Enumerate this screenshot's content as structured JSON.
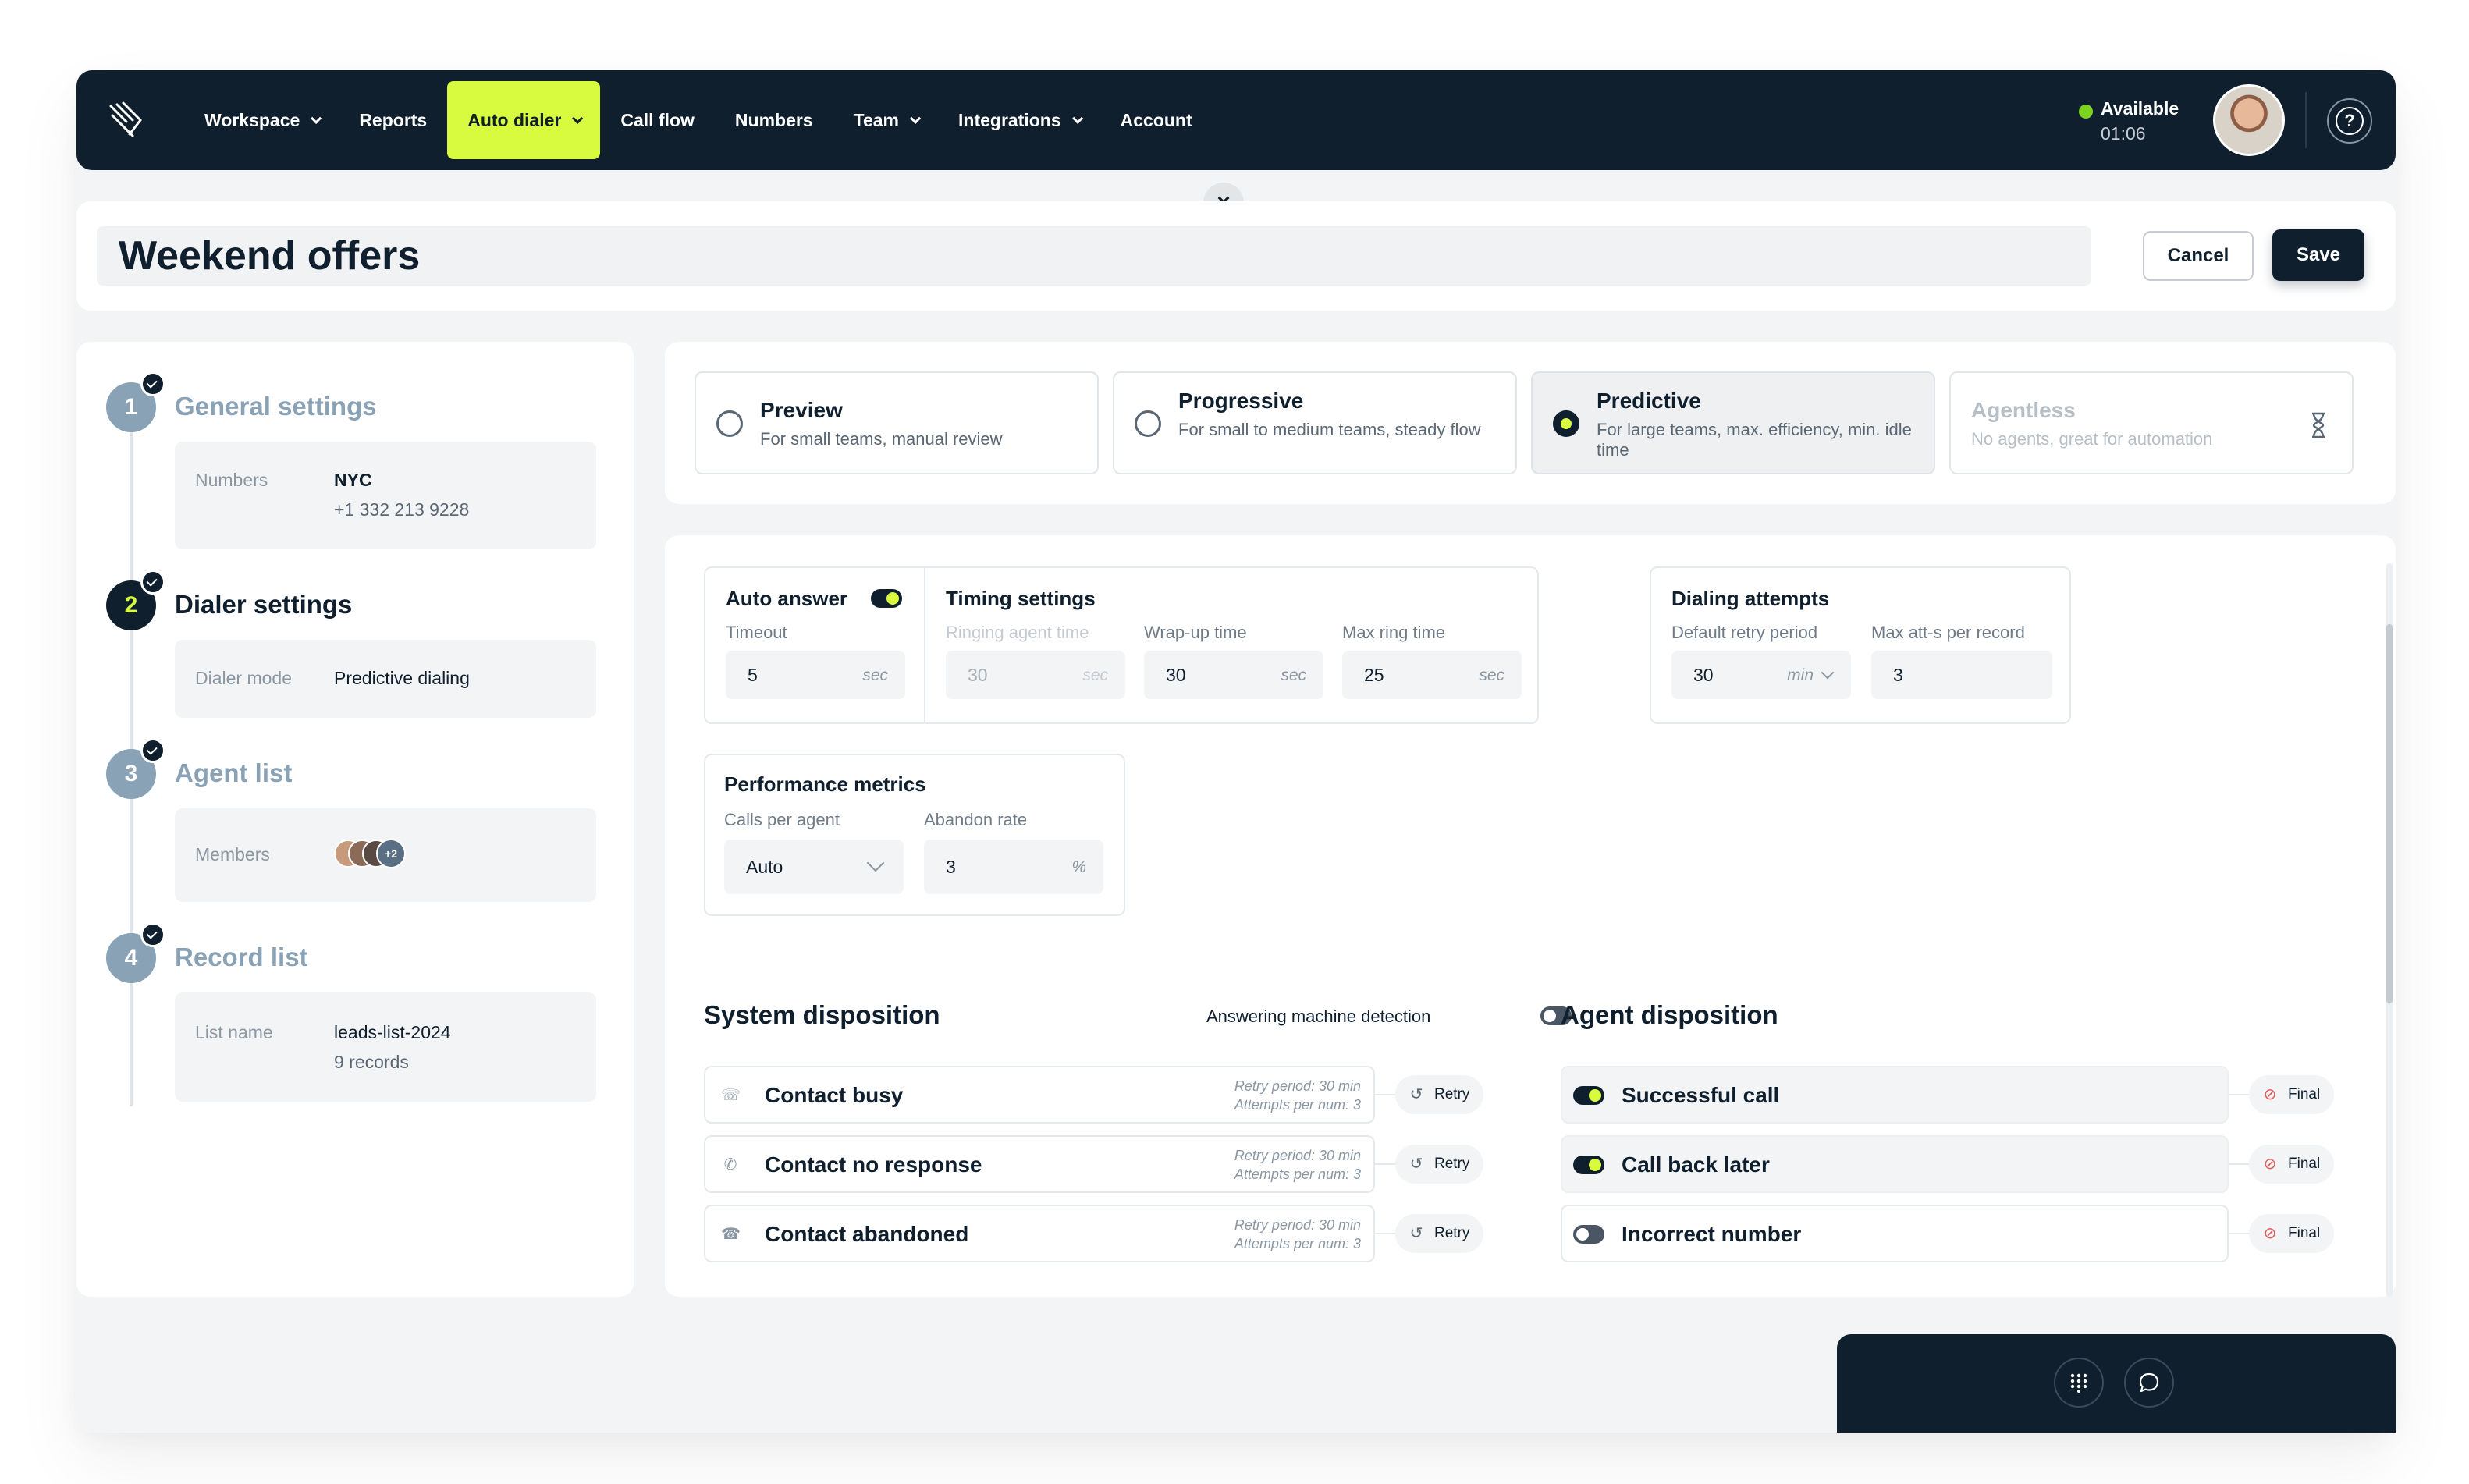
{
  "nav": {
    "items": [
      {
        "label": "Workspace",
        "dropdown": true
      },
      {
        "label": "Reports",
        "dropdown": false
      },
      {
        "label": "Auto dialer",
        "dropdown": true,
        "active": true
      },
      {
        "label": "Call flow",
        "dropdown": false
      },
      {
        "label": "Numbers",
        "dropdown": false
      },
      {
        "label": "Team",
        "dropdown": true
      },
      {
        "label": "Integrations",
        "dropdown": true
      },
      {
        "label": "Account",
        "dropdown": false
      }
    ],
    "status_label": "Available",
    "status_time": "01:06",
    "help_icon": "?"
  },
  "close_icon": "×",
  "header": {
    "title": "Weekend offers",
    "cancel_label": "Cancel",
    "save_label": "Save"
  },
  "steps": [
    {
      "num": "1",
      "title": "General settings",
      "box_label": "Numbers",
      "box_value": "NYC",
      "box_value2": "+1 332 213 9228"
    },
    {
      "num": "2",
      "title": "Dialer settings",
      "box_label": "Dialer mode",
      "box_value": "Predictive dialing"
    },
    {
      "num": "3",
      "title": "Agent list",
      "box_label": "Members",
      "more": "+2"
    },
    {
      "num": "4",
      "title": "Record list",
      "box_label": "List name",
      "box_value": "leads-list-2024",
      "box_value2": "9 records"
    }
  ],
  "modes": [
    {
      "title": "Preview",
      "desc": "For small teams, manual review"
    },
    {
      "title": "Progressive",
      "desc": "For small to medium teams, steady flow"
    },
    {
      "title": "Predictive",
      "desc": "For large teams, max. efficiency, min. idle time"
    },
    {
      "title": "Agentless",
      "desc": "No agents, great for automation"
    }
  ],
  "auto_answer": {
    "title": "Auto answer",
    "timeout_label": "Timeout",
    "timeout_value": "5",
    "timeout_unit": "sec"
  },
  "timing": {
    "title": "Timing settings",
    "ringing_label": "Ringing agent time",
    "ringing_value": "30",
    "ringing_unit": "sec",
    "wrapup_label": "Wrap-up time",
    "wrapup_value": "30",
    "wrapup_unit": "sec",
    "maxring_label": "Max ring time",
    "maxring_value": "25",
    "maxring_unit": "sec"
  },
  "dialing": {
    "title": "Dialing attempts",
    "retry_label": "Default retry period",
    "retry_value": "30",
    "retry_unit": "min",
    "maxatt_label": "Max att-s per record",
    "maxatt_value": "3"
  },
  "performance": {
    "title": "Performance metrics",
    "calls_label": "Calls per agent",
    "calls_value": "Auto",
    "abandon_label": "Abandon rate",
    "abandon_value": "3",
    "abandon_unit": "%"
  },
  "system_disposition": {
    "title": "System disposition",
    "amd_label": "Answering machine detection",
    "rows": [
      {
        "label": "Contact busy",
        "meta1": "Retry period: 30 min",
        "meta2": "Attempts per num: 3",
        "action": "Retry",
        "icon": "phone-busy-icon"
      },
      {
        "label": "Contact no response",
        "meta1": "Retry period: 30 min",
        "meta2": "Attempts per num: 3",
        "action": "Retry",
        "icon": "phone-missed-icon"
      },
      {
        "label": "Contact abandoned",
        "meta1": "Retry period: 30 min",
        "meta2": "Attempts per num: 3",
        "action": "Retry",
        "icon": "phone-hangup-icon"
      }
    ]
  },
  "agent_disposition": {
    "title": "Agent disposition",
    "rows": [
      {
        "label": "Successful call",
        "enabled": true,
        "action": "Final"
      },
      {
        "label": "Call back later",
        "enabled": true,
        "action": "Final"
      },
      {
        "label": "Incorrect number",
        "enabled": false,
        "action": "Final"
      }
    ]
  },
  "colors": {
    "navy": "#0f1f2e",
    "accent": "#d9fb3f",
    "status_green": "#7ed321",
    "muted_step": "#8aa2b6",
    "final_red": "#e05a5a"
  },
  "bottom_bar": {
    "keypad_icon": "keypad-icon",
    "chat_icon": "chat-icon"
  }
}
